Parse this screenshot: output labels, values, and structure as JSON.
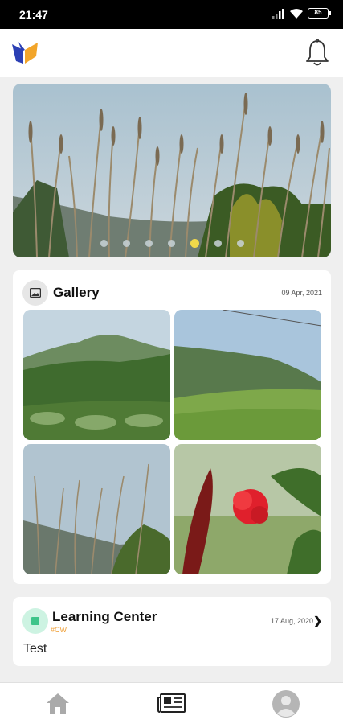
{
  "status_bar": {
    "time": "21:47",
    "battery": "85"
  },
  "carousel": {
    "slide_count": 7,
    "active_index": 4
  },
  "gallery": {
    "title": "Gallery",
    "date": "09 Apr, 2021",
    "photo_count": 4
  },
  "learning_center": {
    "title": "Learning Center",
    "tag": "#CW",
    "date": "17 Aug, 2020",
    "body": "Test"
  },
  "bottom_nav": {
    "items": [
      "home-icon",
      "news-icon",
      "profile-icon"
    ],
    "active": "news-icon"
  },
  "colors": {
    "accent_dot": "#f1d94a",
    "tag": "#f0a13a",
    "learning_icon_bg": "#cdf3e2",
    "logo_blue": "#2b3fb4",
    "logo_orange": "#f2a52a"
  }
}
